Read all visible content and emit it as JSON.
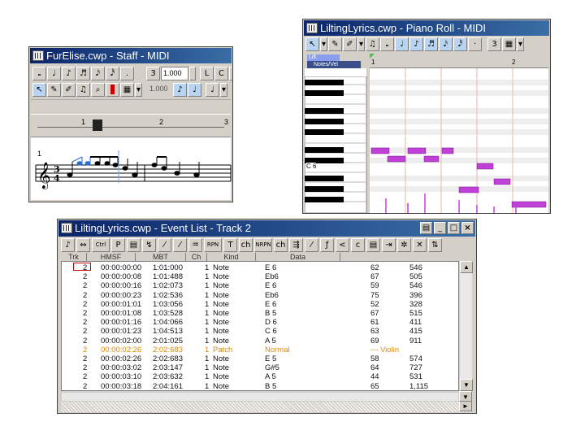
{
  "staff_window": {
    "title": "FurElise.cwp - Staff - MIDI",
    "toolbar_row1": [
      "𝅝",
      "♩",
      "♪",
      "♬",
      "𝅘𝅥𝅯",
      "𝅘𝅥𝅰",
      "."
    ],
    "triplet": "3",
    "duration_value": "1.000",
    "row1_extra": [
      "L",
      "C",
      "𝆑",
      "<"
    ],
    "row2_value": "1.000",
    "measures": [
      "1",
      "2",
      "3"
    ],
    "bar_number": "1",
    "time_sig_top": "3",
    "time_sig_bottom": "4"
  },
  "piano_window": {
    "title": "LiltingLyrics.cwp - Piano Roll - MIDI",
    "track_select": "Lilt",
    "view_select": "Notes/Vel",
    "ruler_marks": [
      "1",
      "2"
    ],
    "c_label": "C 6",
    "toolbar": [
      "↖",
      "✎",
      "✐",
      "✍",
      "♫",
      "𝅝",
      "♩",
      "♪",
      "♬",
      "𝅘𝅥𝅯",
      "𝅘𝅥𝅰",
      "·",
      "3",
      "▦"
    ]
  },
  "event_window": {
    "title": "LiltingLyrics.cwp - Event List - Track 2",
    "toolbar": [
      "♪",
      "⇔",
      "Ctrl",
      "P",
      "▤",
      "↯",
      "⁄",
      "⁄",
      "♒",
      "RPN",
      "T",
      "ch",
      "NRPN",
      "ch",
      "⇶",
      "⁄",
      "ƒ",
      "<",
      "c",
      "▤",
      "⇥",
      "✲",
      "✕",
      "⇅"
    ],
    "columns": [
      "Trk",
      "HMSF",
      "MBT",
      "Ch",
      "Kind",
      "Data"
    ],
    "rows": [
      {
        "trk": "2",
        "hmsf": "00:00:00:00",
        "mbt": "1:01:000",
        "ch": "1",
        "kind": "Note",
        "data": "E 6",
        "v1": "62",
        "v2": "546",
        "hl": false
      },
      {
        "trk": "2",
        "hmsf": "00:00:00:08",
        "mbt": "1:01:488",
        "ch": "1",
        "kind": "Note",
        "data": "Eb6",
        "v1": "67",
        "v2": "505",
        "hl": false
      },
      {
        "trk": "2",
        "hmsf": "00:00:00:16",
        "mbt": "1:02:073",
        "ch": "1",
        "kind": "Note",
        "data": "E 6",
        "v1": "59",
        "v2": "546",
        "hl": false
      },
      {
        "trk": "2",
        "hmsf": "00:00:00:23",
        "mbt": "1:02:536",
        "ch": "1",
        "kind": "Note",
        "data": "Eb6",
        "v1": "75",
        "v2": "396",
        "hl": false
      },
      {
        "trk": "2",
        "hmsf": "00:00:01:01",
        "mbt": "1:03:056",
        "ch": "1",
        "kind": "Note",
        "data": "E 6",
        "v1": "52",
        "v2": "328",
        "hl": false
      },
      {
        "trk": "2",
        "hmsf": "00:00:01:08",
        "mbt": "1:03:528",
        "ch": "1",
        "kind": "Note",
        "data": "B 5",
        "v1": "67",
        "v2": "515",
        "hl": false
      },
      {
        "trk": "2",
        "hmsf": "00:00:01:16",
        "mbt": "1:04:066",
        "ch": "1",
        "kind": "Note",
        "data": "D 6",
        "v1": "61",
        "v2": "411",
        "hl": false
      },
      {
        "trk": "2",
        "hmsf": "00:00:01:23",
        "mbt": "1:04:513",
        "ch": "1",
        "kind": "Note",
        "data": "C 6",
        "v1": "63",
        "v2": "415",
        "hl": false
      },
      {
        "trk": "2",
        "hmsf": "00:00:02:00",
        "mbt": "2:01:025",
        "ch": "1",
        "kind": "Note",
        "data": "A 5",
        "v1": "69",
        "v2": "911",
        "hl": false
      },
      {
        "trk": "2",
        "hmsf": "00:00:02:26",
        "mbt": "2:02:683",
        "ch": "1",
        "kind": "Patch",
        "data": "Normal",
        "v1": "--- Violin",
        "v2": "",
        "hl": true
      },
      {
        "trk": "2",
        "hmsf": "00:00:02:26",
        "mbt": "2:02:683",
        "ch": "1",
        "kind": "Note",
        "data": "E 5",
        "v1": "58",
        "v2": "574",
        "hl": false
      },
      {
        "trk": "2",
        "hmsf": "00:00:03:02",
        "mbt": "2:03:147",
        "ch": "1",
        "kind": "Note",
        "data": "G#5",
        "v1": "64",
        "v2": "727",
        "hl": false
      },
      {
        "trk": "2",
        "hmsf": "00:00:03:10",
        "mbt": "2:03:632",
        "ch": "1",
        "kind": "Note",
        "data": "A 5",
        "v1": "44",
        "v2": "531",
        "hl": false
      },
      {
        "trk": "2",
        "hmsf": "00:00:03:18",
        "mbt": "2:04:161",
        "ch": "1",
        "kind": "Note",
        "data": "B 5",
        "v1": "65",
        "v2": "1,115",
        "hl": false
      }
    ]
  },
  "colors": {
    "note_fill": "#c040d8",
    "highlight_row": "#e08a00",
    "title_bg": "#0a246a"
  }
}
